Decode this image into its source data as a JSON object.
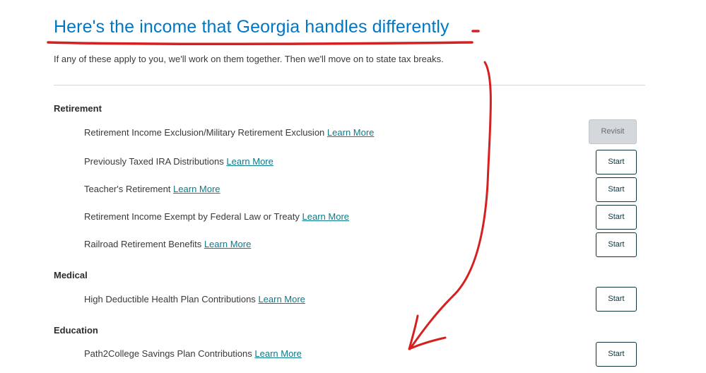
{
  "header": {
    "title": "Here's the income that Georgia handles differently",
    "subtitle": "If any of these apply to you, we'll work on them together. Then we'll move on to state tax breaks."
  },
  "sections": [
    {
      "heading": "Retirement",
      "items": [
        {
          "label": "Retirement Income Exclusion/Military Retirement Exclusion",
          "link": "Learn More",
          "button": "Revisit"
        },
        {
          "label": "Previously Taxed IRA Distributions",
          "link": "Learn More",
          "button": "Start"
        },
        {
          "label": "Teacher's Retirement",
          "link": "Learn More",
          "button": "Start"
        },
        {
          "label": "Retirement Income Exempt by Federal Law or Treaty",
          "link": "Learn More",
          "button": "Start"
        },
        {
          "label": "Railroad Retirement Benefits",
          "link": "Learn More",
          "button": "Start"
        }
      ]
    },
    {
      "heading": "Medical",
      "items": [
        {
          "label": "High Deductible Health Plan Contributions",
          "link": "Learn More",
          "button": "Start"
        }
      ]
    },
    {
      "heading": "Education",
      "items": [
        {
          "label": "Path2College Savings Plan Contributions",
          "link": "Learn More",
          "button": "Start"
        }
      ]
    }
  ],
  "colors": {
    "title": "#0077c5",
    "link": "#0d7a8a",
    "annotation": "#d62020",
    "revisit_bg": "#d4d7dc"
  }
}
